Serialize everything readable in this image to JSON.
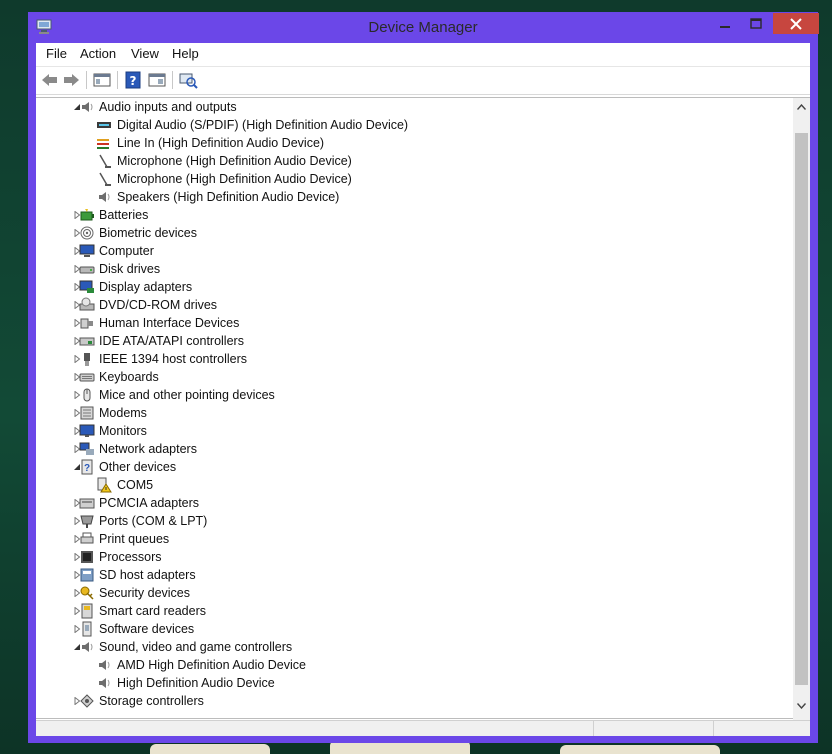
{
  "window": {
    "title": "Device Manager",
    "accent_color": "#6b47e8",
    "close_color": "#c7463f"
  },
  "menu": [
    "File",
    "Action",
    "View",
    "Help"
  ],
  "toolbar": {
    "buttons": [
      "back-icon",
      "forward-icon",
      "show-hide-console-tree-icon",
      "help-icon",
      "properties-icon",
      "scan-hardware-icon"
    ]
  },
  "tree": {
    "items": [
      {
        "label": "Audio inputs and outputs",
        "depth": 0,
        "state": "expanded",
        "icon": "speaker-icon"
      },
      {
        "label": "Digital Audio (S/PDIF) (High Definition Audio Device)",
        "depth": 1,
        "state": "none",
        "icon": "digital-audio-icon"
      },
      {
        "label": "Line In (High Definition Audio Device)",
        "depth": 1,
        "state": "none",
        "icon": "line-in-icon"
      },
      {
        "label": "Microphone (High Definition Audio Device)",
        "depth": 1,
        "state": "none",
        "icon": "microphone-icon"
      },
      {
        "label": "Microphone (High Definition Audio Device)",
        "depth": 1,
        "state": "none",
        "icon": "microphone-icon"
      },
      {
        "label": "Speakers (High Definition Audio Device)",
        "depth": 1,
        "state": "none",
        "icon": "speaker-icon"
      },
      {
        "label": "Batteries",
        "depth": 0,
        "state": "collapsed",
        "icon": "battery-icon"
      },
      {
        "label": "Biometric devices",
        "depth": 0,
        "state": "collapsed",
        "icon": "fingerprint-icon"
      },
      {
        "label": "Computer",
        "depth": 0,
        "state": "collapsed",
        "icon": "computer-icon"
      },
      {
        "label": "Disk drives",
        "depth": 0,
        "state": "collapsed",
        "icon": "disk-drive-icon"
      },
      {
        "label": "Display adapters",
        "depth": 0,
        "state": "collapsed",
        "icon": "display-adapter-icon"
      },
      {
        "label": "DVD/CD-ROM drives",
        "depth": 0,
        "state": "collapsed",
        "icon": "dvd-drive-icon"
      },
      {
        "label": "Human Interface Devices",
        "depth": 0,
        "state": "collapsed",
        "icon": "hid-icon"
      },
      {
        "label": "IDE ATA/ATAPI controllers",
        "depth": 0,
        "state": "collapsed",
        "icon": "ide-controller-icon"
      },
      {
        "label": "IEEE 1394 host controllers",
        "depth": 0,
        "state": "collapsed",
        "icon": "firewire-icon"
      },
      {
        "label": "Keyboards",
        "depth": 0,
        "state": "collapsed",
        "icon": "keyboard-icon"
      },
      {
        "label": "Mice and other pointing devices",
        "depth": 0,
        "state": "collapsed",
        "icon": "mouse-icon"
      },
      {
        "label": "Modems",
        "depth": 0,
        "state": "collapsed",
        "icon": "modem-icon"
      },
      {
        "label": "Monitors",
        "depth": 0,
        "state": "collapsed",
        "icon": "monitor-icon"
      },
      {
        "label": "Network adapters",
        "depth": 0,
        "state": "collapsed",
        "icon": "network-adapter-icon"
      },
      {
        "label": "Other devices",
        "depth": 0,
        "state": "expanded",
        "icon": "unknown-device-icon"
      },
      {
        "label": "COM5",
        "depth": 1,
        "state": "none",
        "icon": "warning-device-icon"
      },
      {
        "label": "PCMCIA adapters",
        "depth": 0,
        "state": "collapsed",
        "icon": "pcmcia-icon"
      },
      {
        "label": "Ports (COM & LPT)",
        "depth": 0,
        "state": "collapsed",
        "icon": "port-icon"
      },
      {
        "label": "Print queues",
        "depth": 0,
        "state": "collapsed",
        "icon": "printer-icon"
      },
      {
        "label": "Processors",
        "depth": 0,
        "state": "collapsed",
        "icon": "processor-icon"
      },
      {
        "label": "SD host adapters",
        "depth": 0,
        "state": "collapsed",
        "icon": "sd-adapter-icon"
      },
      {
        "label": "Security devices",
        "depth": 0,
        "state": "collapsed",
        "icon": "security-key-icon"
      },
      {
        "label": "Smart card readers",
        "depth": 0,
        "state": "collapsed",
        "icon": "smart-card-reader-icon"
      },
      {
        "label": "Software devices",
        "depth": 0,
        "state": "collapsed",
        "icon": "software-device-icon"
      },
      {
        "label": "Sound, video and game controllers",
        "depth": 0,
        "state": "expanded",
        "icon": "speaker-icon"
      },
      {
        "label": "AMD High Definition Audio Device",
        "depth": 1,
        "state": "none",
        "icon": "speaker-icon"
      },
      {
        "label": "High Definition Audio Device",
        "depth": 1,
        "state": "none",
        "icon": "speaker-icon"
      },
      {
        "label": "Storage controllers",
        "depth": 0,
        "state": "collapsed",
        "icon": "storage-controller-icon"
      }
    ]
  }
}
